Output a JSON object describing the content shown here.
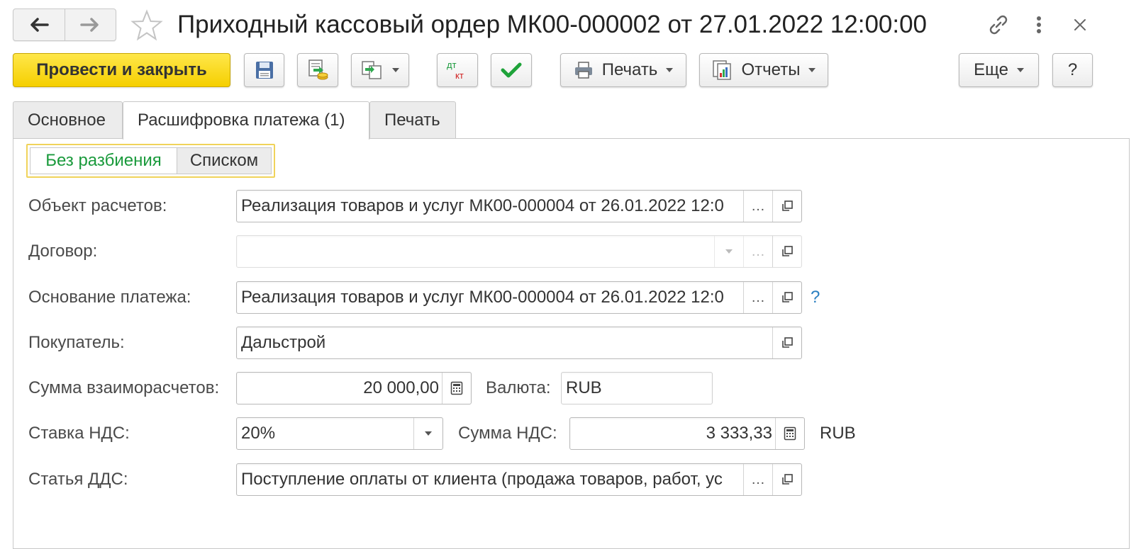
{
  "window": {
    "title": "Приходный кассовый ордер МК00-000002 от 27.01.2022 12:00:00"
  },
  "toolbar": {
    "post_close_label": "Провести и закрыть",
    "print_label": "Печать",
    "reports_label": "Отчеты",
    "more_label": "Еще",
    "help_label": "?",
    "dtkt_top": "дт",
    "dtkt_bottom": "кт"
  },
  "tabs": [
    {
      "label": "Основное",
      "active": false
    },
    {
      "label": "Расшифровка платежа (1)",
      "active": true
    },
    {
      "label": "Печать",
      "active": false
    }
  ],
  "split_switch": {
    "option_1": "Без разбиения",
    "option_2": "Списком",
    "selected": "Без разбиения"
  },
  "form": {
    "settlement_object": {
      "label": "Объект расчетов:",
      "value": "Реализация товаров и услуг МК00-000004 от 26.01.2022 12:0"
    },
    "contract": {
      "label": "Договор:",
      "value": ""
    },
    "payment_basis": {
      "label": "Основание платежа:",
      "value": "Реализация товаров и услуг МК00-000004 от 26.01.2022 12:0",
      "help": "?"
    },
    "buyer": {
      "label": "Покупатель:",
      "value": "Дальстрой"
    },
    "settlement_amount": {
      "label": "Сумма взаиморасчетов:",
      "value": "20 000,00"
    },
    "currency": {
      "label": "Валюта:",
      "value": "RUB"
    },
    "vat_rate": {
      "label": "Ставка НДС:",
      "value": "20%"
    },
    "vat_amount": {
      "label": "Сумма НДС:",
      "value": "3 333,33",
      "currency": "RUB"
    },
    "cash_flow_item": {
      "label": "Статья ДДС:",
      "value": "Поступление оплаты от клиента (продажа товаров, работ, ус"
    }
  },
  "colors": {
    "primary_button": "#f5cf00",
    "active_switch_text": "#1a9a3c",
    "switch_border": "#f0d35a",
    "check_icon": "#1fa33a",
    "help_link": "#2a7fc0"
  }
}
